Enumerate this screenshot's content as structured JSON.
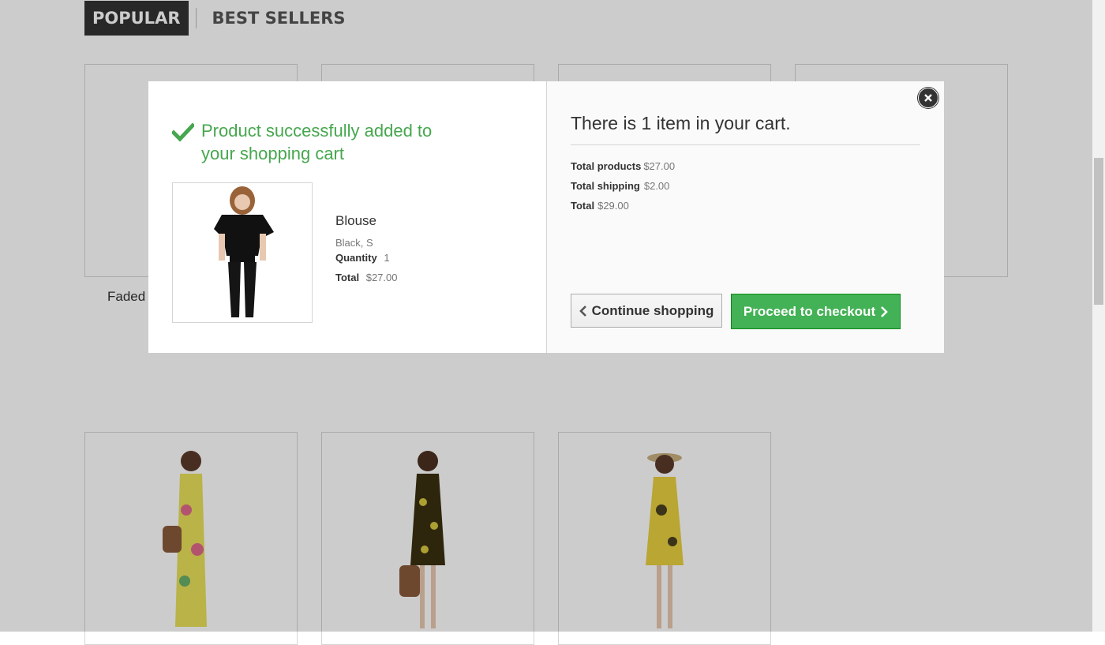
{
  "tabs": {
    "active": "POPULAR",
    "inactive": "BEST SELLERS"
  },
  "products": {
    "first_name_partial": "Faded"
  },
  "modal": {
    "success_message": "Product successfully added to your shopping cart",
    "product": {
      "name": "Blouse",
      "attributes": "Black, S",
      "quantity_label": "Quantity",
      "quantity_value": "1",
      "total_label": "Total",
      "total_value": "$27.00"
    },
    "cart_count_text": "There is 1 item in your cart.",
    "summary": {
      "products_label": "Total products",
      "products_value": "$27.00",
      "shipping_label": "Total shipping",
      "shipping_value": "$2.00",
      "total_label": "Total",
      "total_value": "$29.00"
    },
    "continue_label": "Continue shopping",
    "checkout_label": "Proceed to checkout"
  },
  "colors": {
    "success": "#46a74e",
    "checkout_bg": "#43b155",
    "tab_active_bg": "#333333"
  }
}
